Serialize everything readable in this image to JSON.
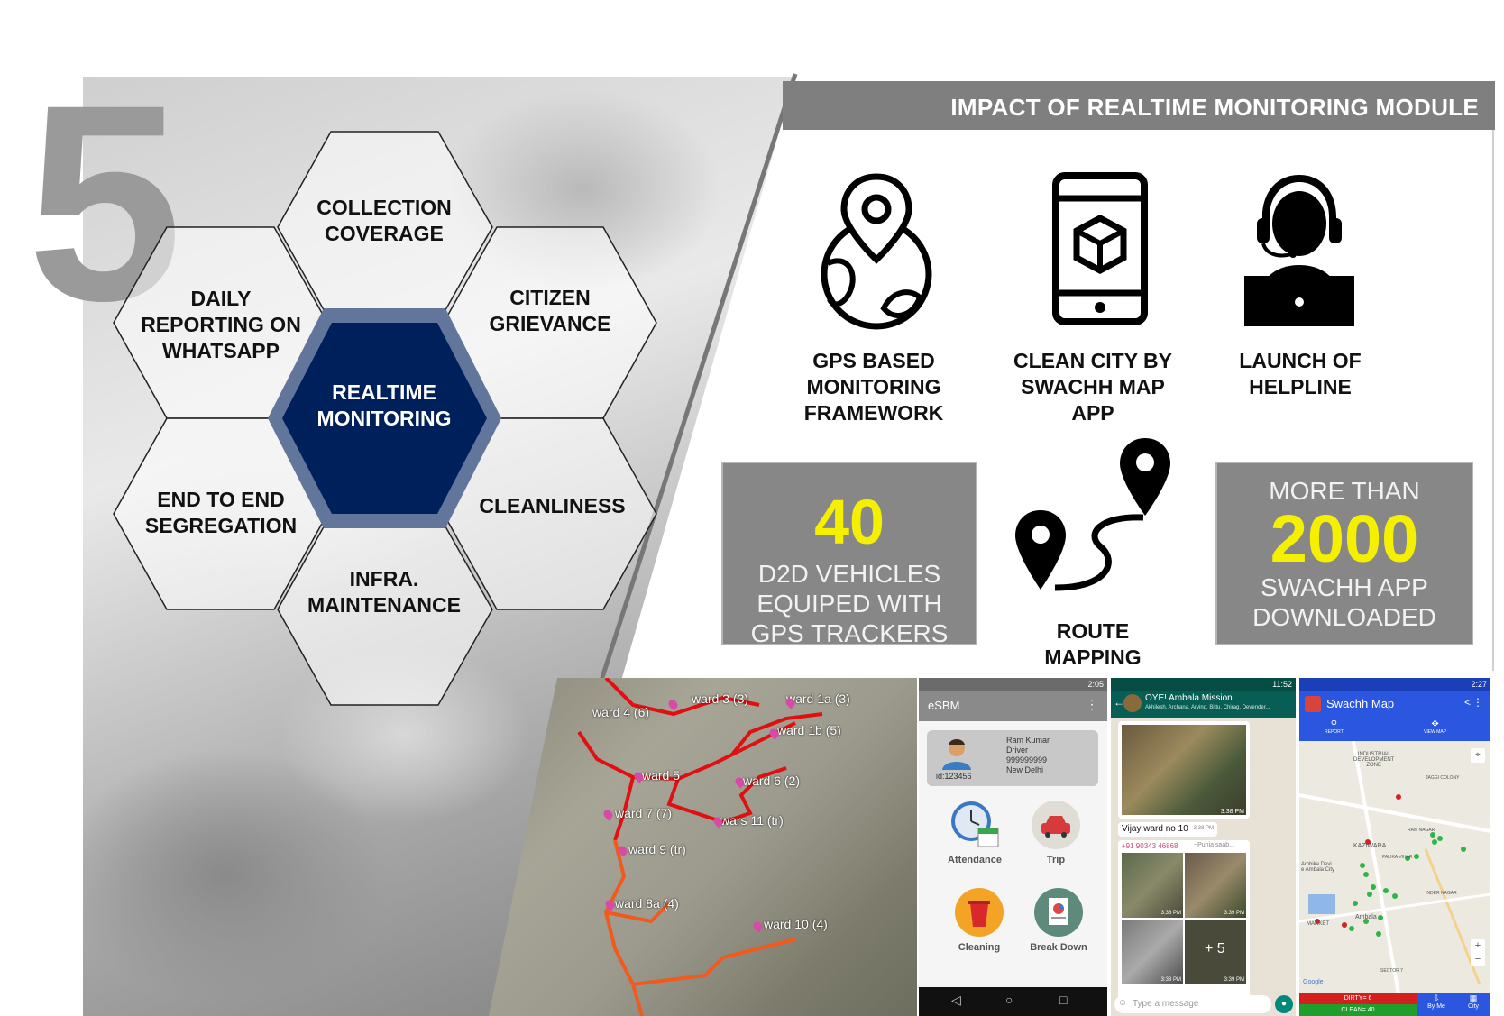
{
  "section_number": "5",
  "hexagons": {
    "center": "REALTIME\nMONITORING",
    "top": "COLLECTION\nCOVERAGE",
    "top_left": "DAILY\nREPORTING ON\nWHATSAPP",
    "top_right": "CITIZEN\nGRIEVANCE",
    "bottom_left": "END TO END\nSEGREGATION",
    "bottom_right": "CLEANLINESS",
    "bottom": "INFRA.\nMAINTENANCE"
  },
  "header": {
    "title": "IMPACT OF REALTIME MONITORING MODULE"
  },
  "features": [
    {
      "icon": "globe-pin-icon",
      "label": "GPS BASED\nMONITORING\nFRAMEWORK"
    },
    {
      "icon": "smartphone-cube-icon",
      "label": "CLEAN CITY BY\nSWACHH MAP\nAPP"
    },
    {
      "icon": "helpline-operator-icon",
      "label": "LAUNCH OF\nHELPLINE"
    },
    {
      "icon": "route-pins-icon",
      "label": "ROUTE\nMAPPING"
    }
  ],
  "stats": [
    {
      "value": "40",
      "text": "D2D VEHICLES\nEQUIPED WITH\nGPS TRACKERS"
    },
    {
      "prefix": "MORE THAN",
      "value": "2000",
      "text": "SWACHH APP\nDOWNLOADED"
    }
  ],
  "map": {
    "wards": [
      "ward 4 (6)",
      "ward 3 (3)",
      "ward 1a (3)",
      "ward 1b (5)",
      "ward 5",
      "ward 6 (2)",
      "ward 7 (7)",
      "wars 11 (tr)",
      "ward 9 (tr)",
      "ward 8a (4)",
      "ward 10 (4)"
    ]
  },
  "esbm": {
    "status_time": "2:05",
    "app_title": "eSBM",
    "profile": {
      "name": "Ram Kumar",
      "role": "Driver",
      "phone": "999999999",
      "city": "New Delhi",
      "id": "id:123456"
    },
    "tiles": [
      "Attendance",
      "Trip",
      "Cleaning",
      "Break Down"
    ]
  },
  "whatsapp": {
    "status_time": "11:52",
    "group_name": "OYE! Ambala Mission",
    "members": "Akhilesh, Archana, Arvind, Bittu, Chirag, Devender...",
    "msg_time_1": "3:38 PM",
    "caption": "Vijay ward no 10",
    "caption_time": "3:38 PM",
    "sender": "+91 90343 46868",
    "sender_name": "~Punia saab...",
    "thumb_times": [
      "3:38 PM",
      "3:39 PM",
      "3:38 PM",
      "3:39 PM"
    ],
    "more_count": "+ 5",
    "input_placeholder": "Type a message"
  },
  "swachh": {
    "status_time": "2:27",
    "app_title": "Swachh Map",
    "tabs": [
      "REPORT",
      "VIEW MAP"
    ],
    "map_labels": [
      "INDUSTRIAL\nDEVELOPMENT\nZONE",
      "JAGGI COLONY",
      "KAZIWARA",
      "RAM NAGAR",
      "PALIKA VIHAR",
      "Ambika Devi\ne Ambala City",
      "INDER NAGAR",
      "Ambala",
      "MARKET",
      "SECTOR 7",
      "Google"
    ],
    "footer": {
      "dirty": "DIRTY= 6",
      "clean": "CLEAN= 40",
      "by_me": "By Me",
      "city": "City"
    }
  }
}
